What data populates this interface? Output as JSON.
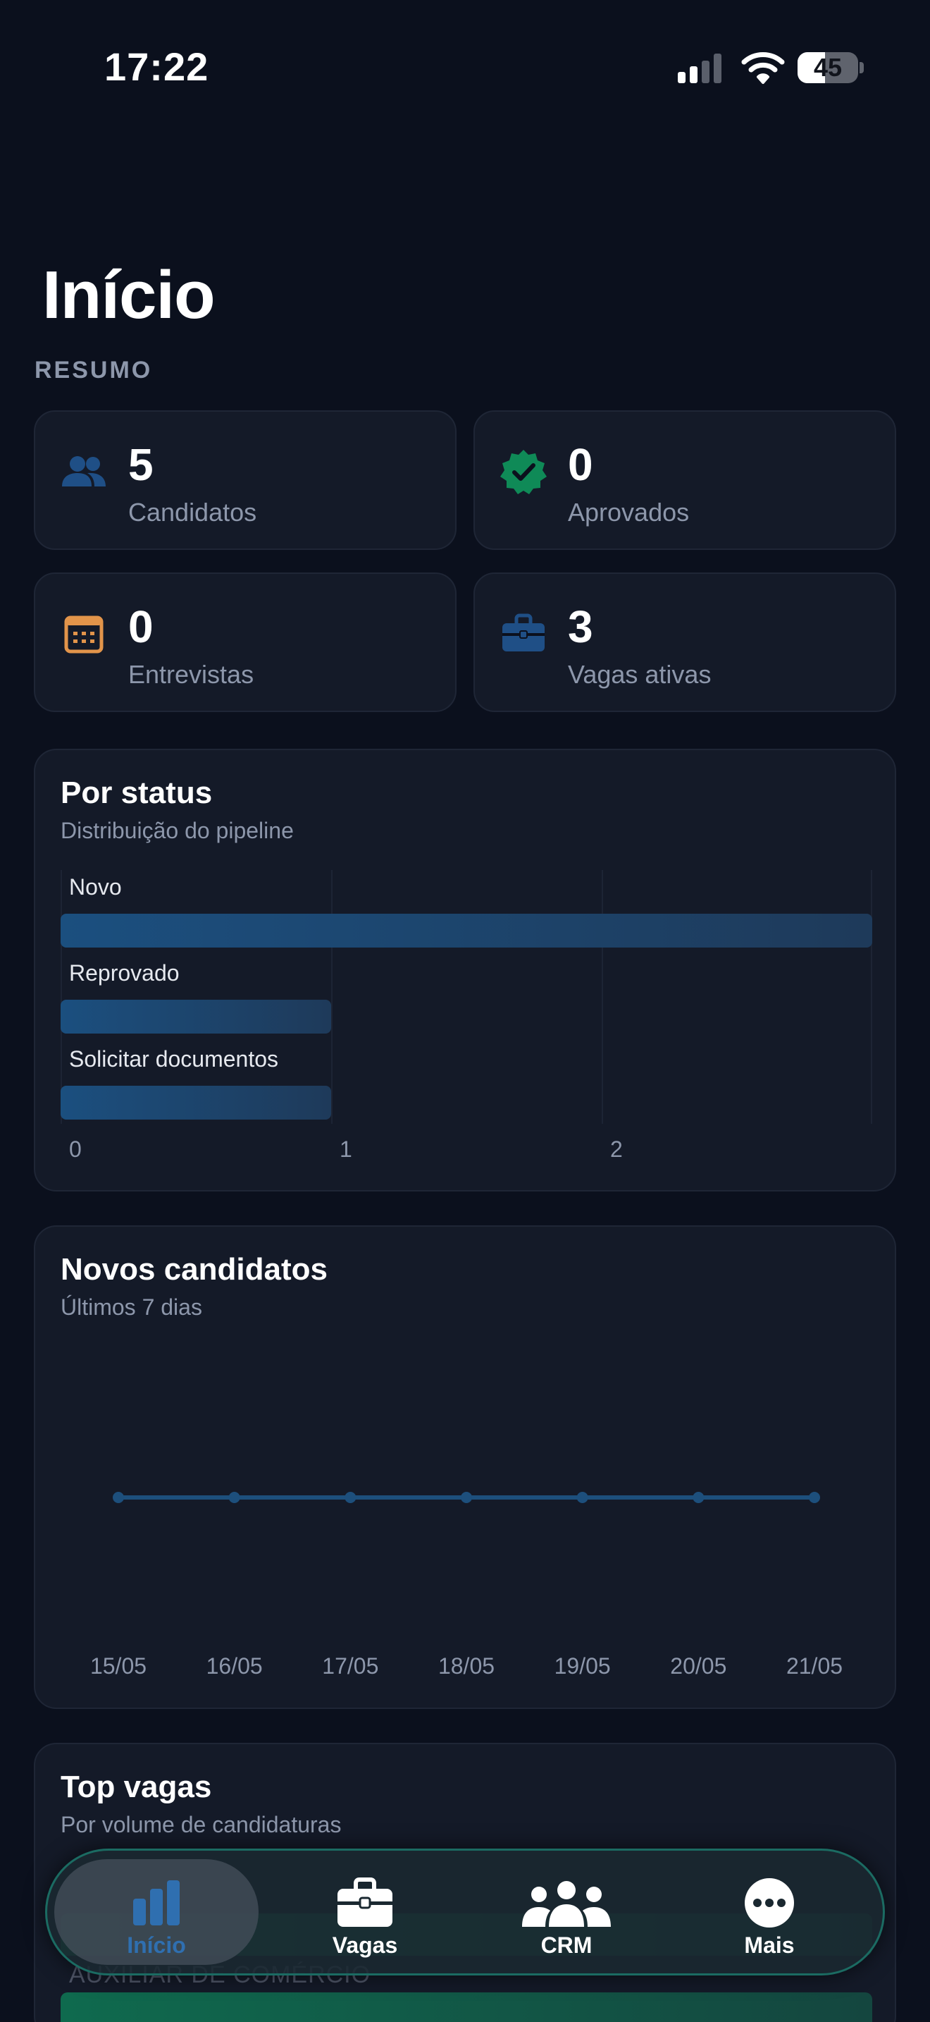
{
  "status_bar": {
    "time": "17:22",
    "battery": "45",
    "battery_level": 0.45
  },
  "page": {
    "title": "Início",
    "section_label": "RESUMO"
  },
  "stats": [
    {
      "value": "5",
      "label": "Candidatos",
      "icon": "users-icon",
      "color": "#1f4f86"
    },
    {
      "value": "0",
      "label": "Aprovados",
      "icon": "verified-badge-icon",
      "color": "#0f8a57"
    },
    {
      "value": "0",
      "label": "Entrevistas",
      "icon": "calendar-icon",
      "color": "#e2944a"
    },
    {
      "value": "3",
      "label": "Vagas ativas",
      "icon": "briefcase-icon",
      "color": "#1f4f86"
    }
  ],
  "status_panel": {
    "title": "Por status",
    "subtitle": "Distribuição do pipeline",
    "chart_data": {
      "type": "bar",
      "orientation": "horizontal",
      "categories": [
        "Novo",
        "Reprovado",
        "Solicitar documentos"
      ],
      "values": [
        3,
        1,
        1
      ],
      "xlim": [
        0,
        3
      ],
      "ticks": [
        "0",
        "1",
        "2"
      ],
      "grid": true
    }
  },
  "new_candidates_panel": {
    "title": "Novos candidatos",
    "subtitle": "Últimos 7 dias",
    "chart_data": {
      "type": "line",
      "categories": [
        "15/05",
        "16/05",
        "17/05",
        "18/05",
        "19/05",
        "20/05",
        "21/05"
      ],
      "values": [
        0,
        0,
        0,
        0,
        0,
        0,
        0
      ],
      "grid": false
    }
  },
  "top_jobs_panel": {
    "title": "Top vagas",
    "subtitle": "Por volume de candidaturas",
    "partial_label": "AUXILIAR DE COMÉRCIO"
  },
  "tab_bar": {
    "tabs": [
      {
        "label": "Início",
        "icon": "bar-chart-icon",
        "active": true
      },
      {
        "label": "Vagas",
        "icon": "briefcase-icon",
        "active": false
      },
      {
        "label": "CRM",
        "icon": "group-icon",
        "active": false
      },
      {
        "label": "Mais",
        "icon": "more-icon",
        "active": false
      }
    ],
    "active_color": "#2f6fb0"
  }
}
